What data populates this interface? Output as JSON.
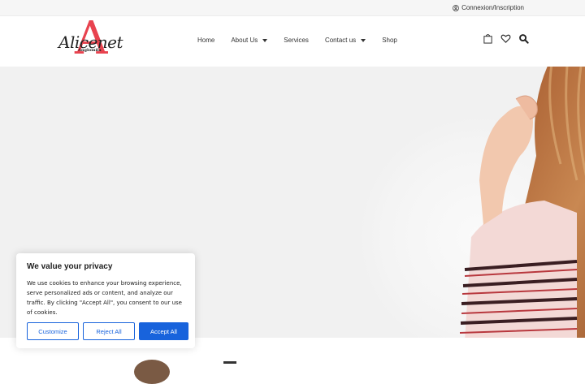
{
  "topbar": {
    "login_label": "Connexion/Inscription",
    "login_icon": "user-circle-icon"
  },
  "logo": {
    "initial": "A",
    "script": "Alicenet",
    "subtitle": "Anglomila"
  },
  "nav": {
    "items": [
      {
        "label": "Home",
        "dropdown": false
      },
      {
        "label": "About Us",
        "dropdown": true
      },
      {
        "label": "Services",
        "dropdown": false
      },
      {
        "label": "Contact us",
        "dropdown": true
      },
      {
        "label": "Shop",
        "dropdown": false
      }
    ]
  },
  "header_icons": [
    "cart-icon",
    "heart-icon",
    "search-icon"
  ],
  "cookie": {
    "title": "We value your privacy",
    "text": "We use cookies to enhance your browsing experience, serve personalized ads or content, and analyze our traffic. By clicking \"Accept All\", you consent to our use of cookies.",
    "customize_label": "Customize",
    "reject_label": "Reject All",
    "accept_label": "Accept All"
  },
  "colors": {
    "brand_red": "#e8434f",
    "cookie_blue": "#1863dc",
    "hero_bg": "#f1f1f1"
  }
}
